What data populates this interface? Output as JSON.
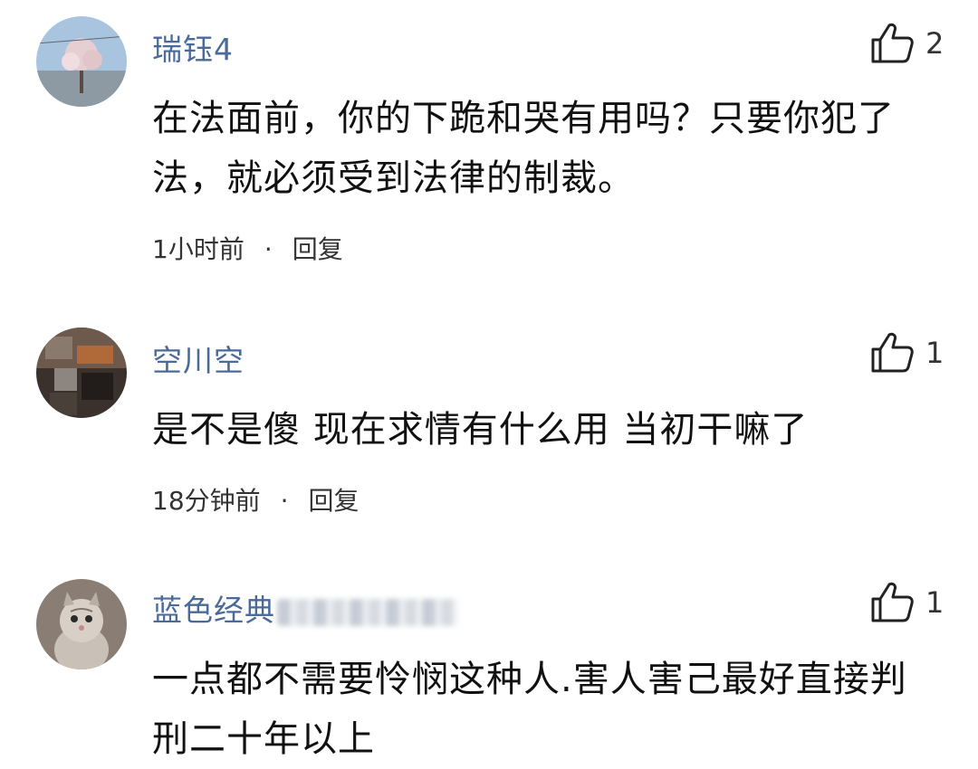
{
  "comments": [
    {
      "username": "瑞钰4",
      "likes": "2",
      "text": "在法面前，你的下跪和哭有用吗？只要你犯了法，就必须受到法律的制裁。",
      "time": "1小时前",
      "separator": "·",
      "reply_label": "回复"
    },
    {
      "username": "空川空",
      "likes": "1",
      "text": "是不是傻 现在求情有什么用 当初干嘛了",
      "time": "18分钟前",
      "separator": "·",
      "reply_label": "回复"
    },
    {
      "username": "蓝色经典",
      "likes": "1",
      "text": "一点都不需要怜悯这种人.害人害己最好直接判刑二十年以上",
      "time": "",
      "separator": "",
      "reply_label": ""
    }
  ],
  "colors": {
    "username": "#4a6a9a",
    "text": "#111111",
    "meta": "#333333"
  },
  "icons": {
    "like": "thumbs-up-outline-icon"
  }
}
